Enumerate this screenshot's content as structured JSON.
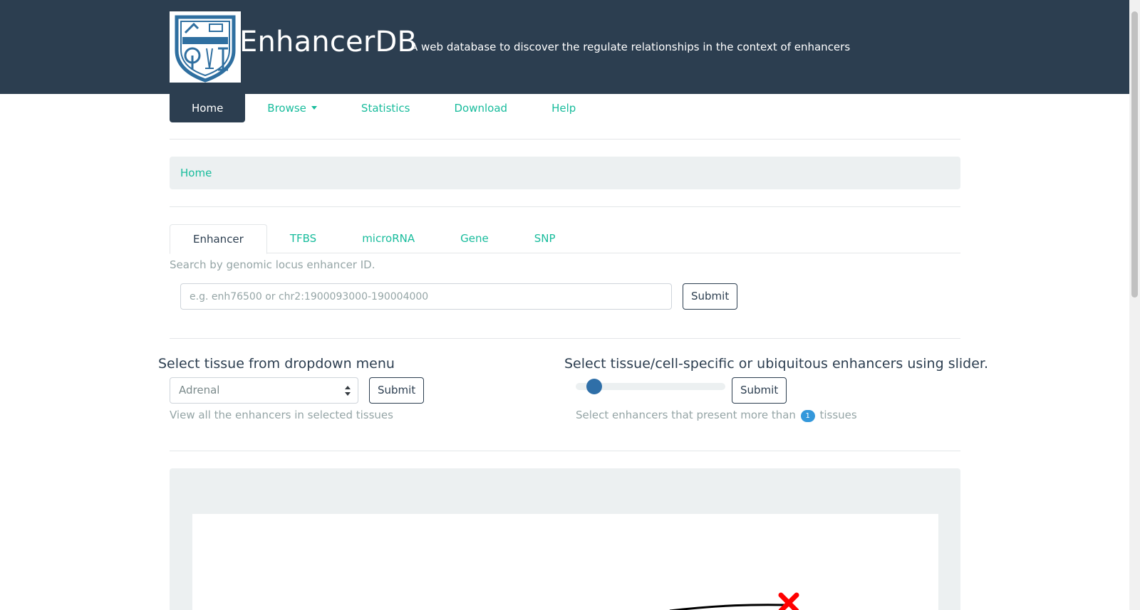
{
  "header": {
    "title": "EnhancerDB",
    "subtitle": "A web database to discover the regulate relationships in the context of enhancers",
    "logo_icon": "university-seal-logo"
  },
  "nav": {
    "items": [
      {
        "label": "Home",
        "active": true
      },
      {
        "label": "Browse",
        "dropdown": true
      },
      {
        "label": "Statistics"
      },
      {
        "label": "Download"
      },
      {
        "label": "Help"
      }
    ]
  },
  "breadcrumb": {
    "current": "Home"
  },
  "search": {
    "tabs": [
      {
        "label": "Enhancer",
        "active": true
      },
      {
        "label": "TFBS"
      },
      {
        "label": "microRNA"
      },
      {
        "label": "Gene"
      },
      {
        "label": "SNP"
      }
    ],
    "help": "Search by genomic locus enhancer ID.",
    "placeholder": "e.g. enh76500 or chr2:1900093000-190004000",
    "submit_label": "Submit"
  },
  "tissue_select": {
    "heading": "Select tissue from dropdown menu",
    "selected": "Adrenal",
    "submit_label": "Submit",
    "help": "View all the enhancers in selected tissues"
  },
  "slider": {
    "heading": "Select tissue/cell-specific or ubiquitous enhancers using slider.",
    "value": 1,
    "submit_label": "Submit",
    "help_prefix": "Select enhancers that present more than",
    "help_value": "1",
    "help_suffix": "tissues"
  },
  "colors": {
    "navbar": "#2c3e50",
    "link": "#18bc9c",
    "slider_thumb": "#2f6fa8",
    "badge": "#3498db",
    "marker": "#ff0000"
  }
}
